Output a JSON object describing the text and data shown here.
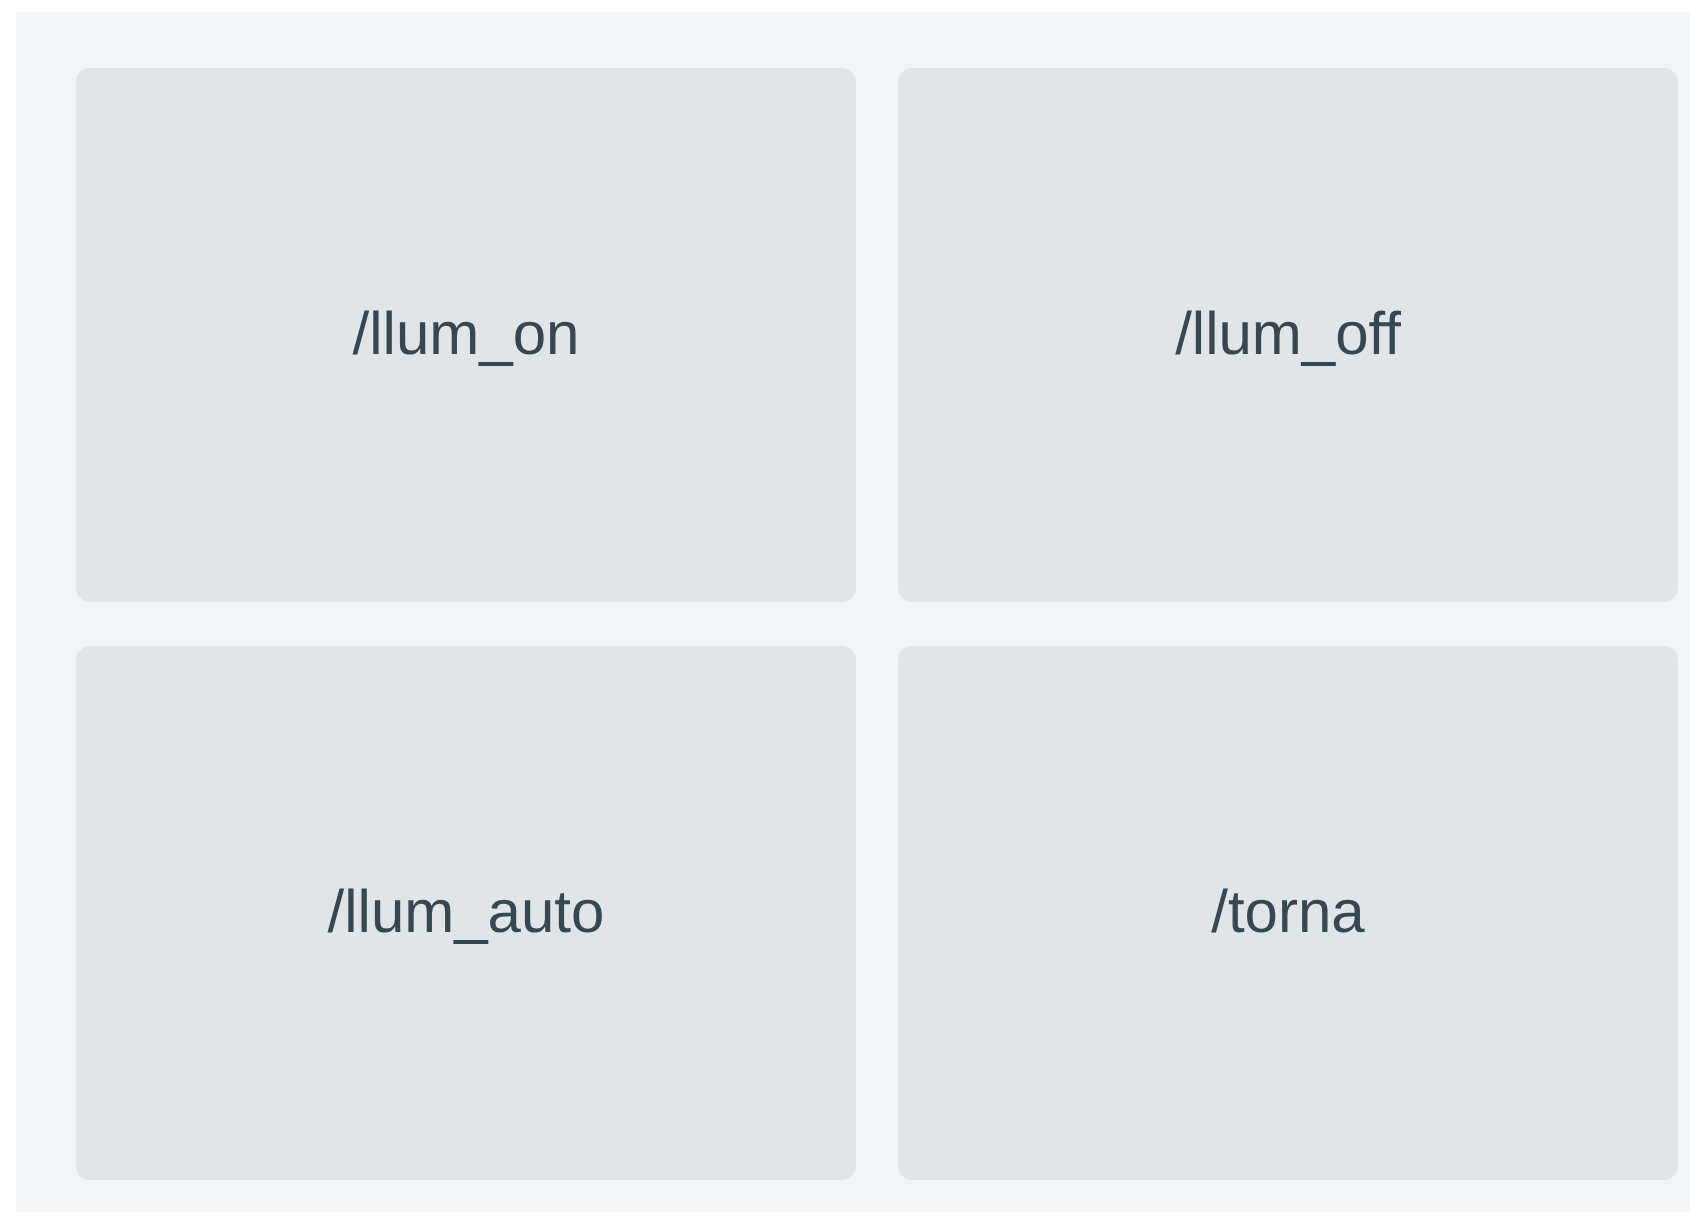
{
  "keyboard": {
    "buttons": [
      {
        "label": "/llum_on"
      },
      {
        "label": "/llum_off"
      },
      {
        "label": "/llum_auto"
      },
      {
        "label": "/torna"
      }
    ]
  }
}
